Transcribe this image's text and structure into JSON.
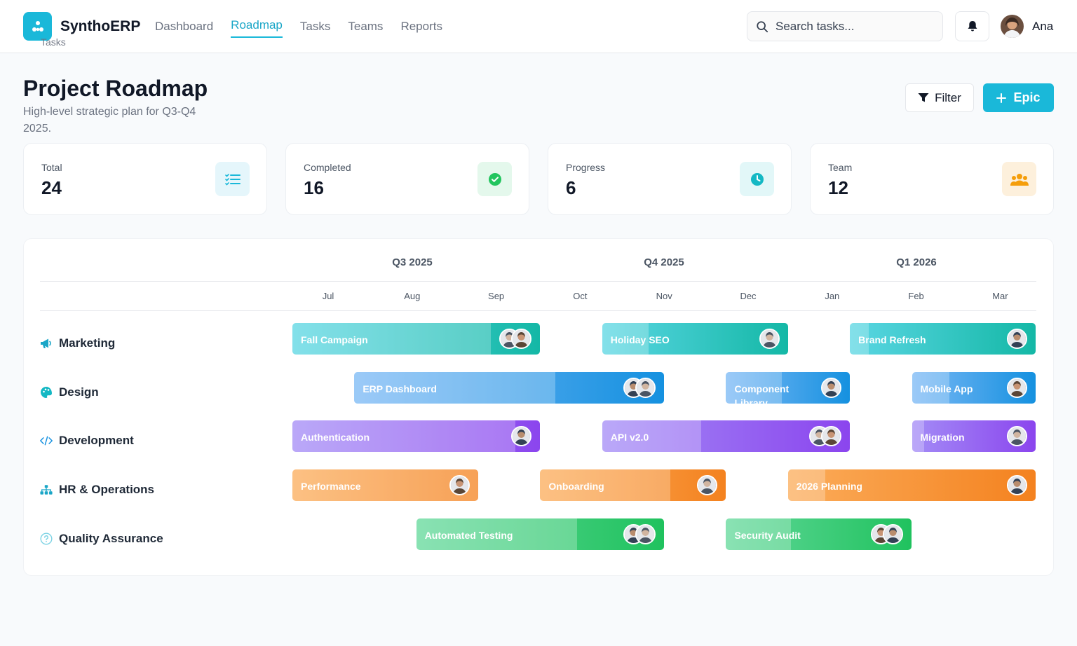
{
  "app": {
    "name": "SynthoERP"
  },
  "nav": [
    {
      "label": "Dashboard",
      "active": false
    },
    {
      "label": "Roadmap",
      "active": true
    },
    {
      "label": "Tasks",
      "active": false
    },
    {
      "label": "Teams",
      "active": false
    },
    {
      "label": "Reports",
      "active": false
    }
  ],
  "search": {
    "placeholder": "Search tasks..."
  },
  "user": {
    "name": "Ana"
  },
  "page": {
    "title": "Project Roadmap",
    "subtitle": "High-level strategic plan for Q3-Q4 2025.",
    "filter_label": "Filter",
    "epic_label": "Epic"
  },
  "stats": [
    {
      "label": "Total",
      "value": "24",
      "overlay": "Tasks",
      "icon": "task-list-icon",
      "color": "#1ab8d9"
    },
    {
      "label": "Completed",
      "value": "16",
      "icon": "check-circle-icon",
      "color": "#22c55e"
    },
    {
      "label": "Progress",
      "value": "6",
      "icon": "clock-icon",
      "color": "#14b8c4"
    },
    {
      "label": "Team",
      "value": "12",
      "icon": "users-icon",
      "color": "#f59e0b"
    }
  ],
  "timeline": {
    "quarters": [
      "Q3 2025",
      "Q4 2025",
      "Q1 2026"
    ],
    "months": [
      "Jul",
      "Aug",
      "Sep",
      "Oct",
      "Nov",
      "Dec",
      "Jan",
      "Feb",
      "Mar"
    ],
    "rows": [
      {
        "label": "Marketing",
        "icon": "megaphone-icon",
        "epics": [
          {
            "label": "Fall Campaign",
            "start": 0,
            "end": 3,
            "progress": 0.8,
            "avatars": 2
          },
          {
            "label": "Holiday SEO",
            "start": 3.75,
            "end": 6,
            "progress": 0.25,
            "avatars": 1
          },
          {
            "label": "Brand Refresh",
            "start": 6.75,
            "end": 9,
            "progress": 0.1,
            "avatars": 1
          }
        ]
      },
      {
        "label": "Design",
        "icon": "palette-icon",
        "epics": [
          {
            "label": "ERP Dashboard",
            "start": 0.75,
            "end": 4.5,
            "progress": 0.65,
            "avatars": 2
          },
          {
            "label": "Component Library",
            "start": 5.25,
            "end": 6.75,
            "progress": 0.45,
            "avatars": 1
          },
          {
            "label": "Mobile App",
            "start": 7.5,
            "end": 9,
            "progress": 0.3,
            "avatars": 1
          }
        ]
      },
      {
        "label": "Development",
        "icon": "code-icon",
        "epics": [
          {
            "label": "Authentication",
            "start": 0,
            "end": 3,
            "progress": 0.9,
            "avatars": 1
          },
          {
            "label": "API v2.0",
            "start": 3.75,
            "end": 6.75,
            "progress": 0.4,
            "avatars": 2
          },
          {
            "label": "Migration",
            "start": 7.5,
            "end": 9,
            "progress": 0.1,
            "avatars": 1
          }
        ]
      },
      {
        "label": "HR & Operations",
        "icon": "org-chart-icon",
        "epics": [
          {
            "label": "Performance",
            "start": 0,
            "end": 2.25,
            "progress": 1.0,
            "avatars": 1
          },
          {
            "label": "Onboarding",
            "start": 3,
            "end": 5.25,
            "progress": 0.7,
            "avatars": 1
          },
          {
            "label": "2026 Planning",
            "start": 6,
            "end": 9,
            "progress": 0.15,
            "avatars": 1
          }
        ]
      },
      {
        "label": "Quality Assurance",
        "icon": "question-circle-icon",
        "epics": [
          {
            "label": "Automated Testing",
            "start": 1.5,
            "end": 4.5,
            "progress": 0.65,
            "avatars": 2
          },
          {
            "label": "Security Audit",
            "start": 5.25,
            "end": 7.5,
            "progress": 0.35,
            "avatars": 2
          }
        ]
      }
    ]
  },
  "colors": {
    "accent": "#1ab8d9",
    "marketing": [
      "#5ad6e3",
      "#14b8a6"
    ],
    "design": [
      "#7ab8f5",
      "#1591e0"
    ],
    "development": [
      "#a38bf6",
      "#8b45ee"
    ],
    "hr": [
      "#fbac5a",
      "#f4821f"
    ],
    "qa": [
      "#62d89a",
      "#20c25e"
    ]
  }
}
